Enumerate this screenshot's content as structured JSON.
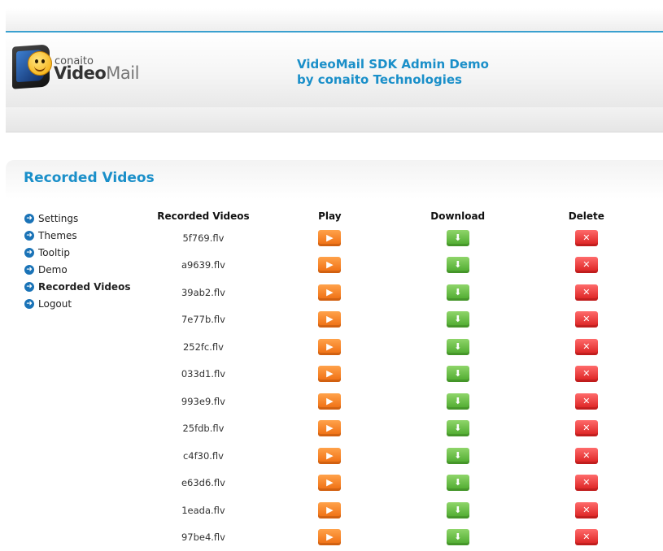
{
  "header": {
    "logo_small": "conaito",
    "logo_big_bold": "Video",
    "logo_big_light": "Mail",
    "title_line1": "VideoMail SDK Admin Demo",
    "title_line2": "by conaito Technologies"
  },
  "section": {
    "title": "Recorded Videos"
  },
  "sidebar": {
    "items": [
      {
        "label": "Settings",
        "active": false
      },
      {
        "label": "Themes",
        "active": false
      },
      {
        "label": "Tooltip",
        "active": false
      },
      {
        "label": "Demo",
        "active": false
      },
      {
        "label": "Recorded Videos",
        "active": true
      },
      {
        "label": "Logout",
        "active": false
      }
    ]
  },
  "table": {
    "headers": [
      "Recorded Videos",
      "Play",
      "Download",
      "Delete"
    ],
    "rows": [
      "5f769.flv",
      "a9639.flv",
      "39ab2.flv",
      "7e77b.flv",
      "252fc.flv",
      "033d1.flv",
      "993e9.flv",
      "25fdb.flv",
      "c4f30.flv",
      "e63d6.flv",
      "1eada.flv",
      "97be4.flv"
    ]
  },
  "icons": {
    "nav_bullet": "arrow-right-circle-icon",
    "play": "play-icon",
    "download": "download-arrow-icon",
    "delete": "x-delete-icon"
  },
  "colors": {
    "accent": "#1a8fc9",
    "play": "#f07a1a",
    "download": "#5bb83a",
    "delete": "#e02a2a"
  }
}
